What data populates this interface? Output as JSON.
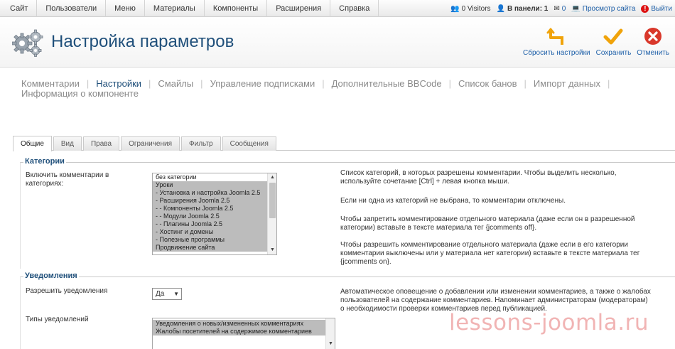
{
  "menu": {
    "items": [
      "Сайт",
      "Пользователи",
      "Меню",
      "Материалы",
      "Компоненты",
      "Расширения",
      "Справка"
    ]
  },
  "status": {
    "visitors": "0 Visitors",
    "panel": "В панели: 1",
    "messages": "0",
    "preview": "Просмотр сайта",
    "logout": "Выйти"
  },
  "header": {
    "title": "Настройка параметров"
  },
  "toolbar": {
    "reset_label": "Сбросить настройки",
    "save_label": "Сохранить",
    "cancel_label": "Отменить"
  },
  "submenu": {
    "items": [
      "Комментарии",
      "Настройки",
      "Смайлы",
      "Управление подписками",
      "Дополнительные BBCode",
      "Список банов",
      "Импорт данных",
      "Информация о компоненте"
    ],
    "active_index": 1
  },
  "tabs": [
    "Общие",
    "Вид",
    "Права",
    "Ограничения",
    "Фильтр",
    "Сообщения"
  ],
  "categories": {
    "legend": "Категории",
    "enable_label": "Включить комментарии в категориях:",
    "options": [
      {
        "text": "без категории",
        "selected": false
      },
      {
        "text": "Уроки",
        "selected": true
      },
      {
        "text": "- Установка и настройка Joomla 2.5",
        "selected": true
      },
      {
        "text": "- Расширения Joomla 2.5",
        "selected": true
      },
      {
        "text": "- - Компоненты Joomla 2.5",
        "selected": true
      },
      {
        "text": "- - Модули Joomla 2.5",
        "selected": true
      },
      {
        "text": "- - Плагины Joomla 2.5",
        "selected": true
      },
      {
        "text": "- Хостинг и домены",
        "selected": true
      },
      {
        "text": "- Полезные программы",
        "selected": true
      },
      {
        "text": "Продвижение сайта",
        "selected": true
      }
    ],
    "desc1": "Список категорий, в которых разрешены комментарии. Чтобы выделить несколько, используйте сочетание [Ctrl] + левая кнопка мыши.",
    "desc2": "Если ни одна из категорий не выбрана, то комментарии отключены.",
    "desc3": "Чтобы запретить комментирование отдельного материала (даже если он в разрешенной категории) вставьте в тексте материала тег {jcomments off}.",
    "desc4": "Чтобы разрешить комментирование отдельного материала (даже если в его категории комментарии выключены или у материала нет категории) вставьте в тексте материала тег {jcomments on}."
  },
  "notifications": {
    "legend": "Уведомления",
    "allow_label": "Разрешить уведомления",
    "allow_value": "Да",
    "allow_desc": "Автоматическое оповещение о добавлении или изменении комментариев, а также о жалобах пользователей на содержание комментариев. Напоминает администраторам (модераторам) о необходимости проверки комментариев перед публикацией.",
    "types_label": "Типы уведомлений",
    "types": [
      {
        "text": "Уведомления о новых/измененных комментариях",
        "selected": true
      },
      {
        "text": "Жалобы посетителей на содержимое комментариев",
        "selected": true
      }
    ]
  },
  "watermark": "lessons-joomla.ru",
  "colors": {
    "title": "#1f4f7a",
    "link": "#1d5fa8",
    "save_check": "#f0a30a",
    "cancel_red": "#d9382b"
  }
}
